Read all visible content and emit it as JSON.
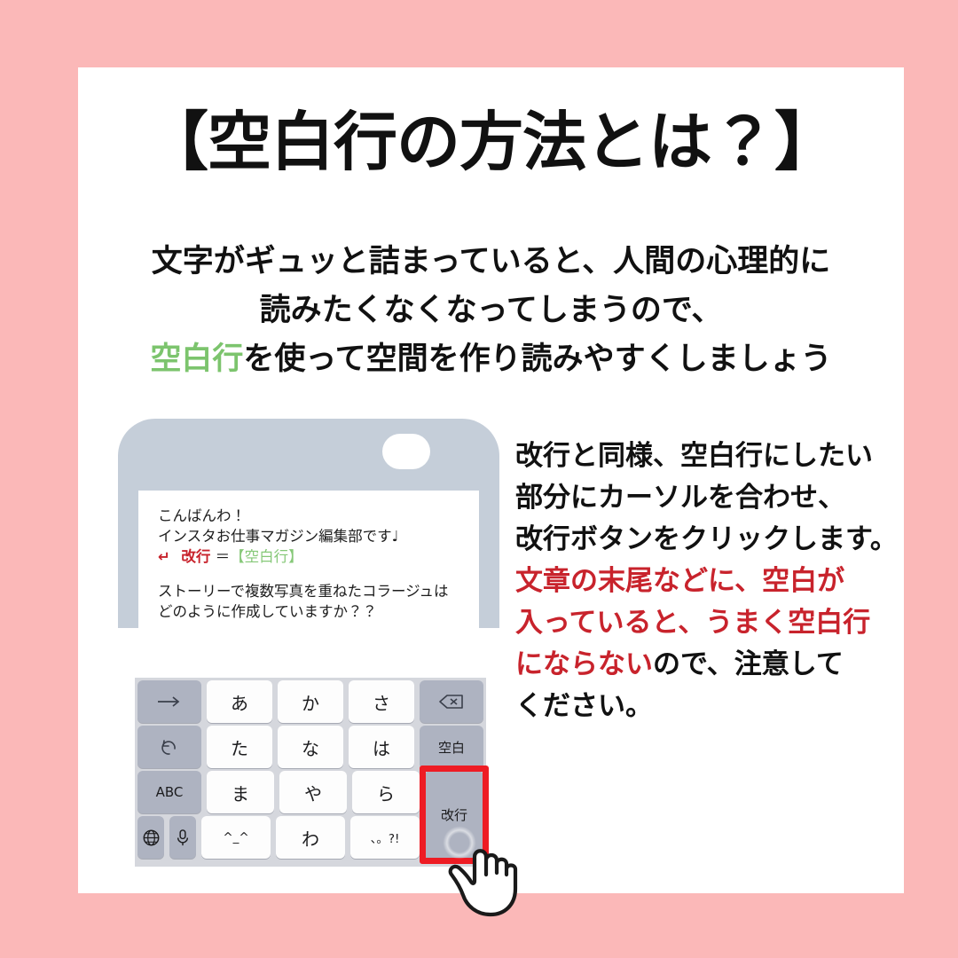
{
  "theme": {
    "page_background": "#fbb8b8",
    "card_background": "#ffffff",
    "text_primary": "#111111",
    "accent_green": "#7cc46d",
    "accent_red": "#c8232c",
    "highlight_red": "#ee1c24",
    "phone_body": "#c5ced9",
    "keyboard_background": "#d5d7dd",
    "key_gray": "#aeb3c1",
    "key_white": "#fdfdfd"
  },
  "title": "【空白行の方法とは？】",
  "lead": {
    "line1": "文字がギュッと詰まっていると、人間の心理的に",
    "line2": "読みたくなくなってしまうので、",
    "line3_green": "空白行",
    "line3_rest": "を使って空間を作り読みやすくしましょう"
  },
  "side_copy": {
    "line1": "改行と同様、空白行にしたい",
    "line2": "部分にカーソルを合わせ、",
    "line3": "改行ボタンをクリックします。",
    "line4_red": "文章の末尾などに、空白が",
    "line5_red": "入っていると、うまく空白行",
    "line6_red": "にならない",
    "line6_rest": "ので、注意して",
    "line7": "ください。"
  },
  "phone": {
    "message": {
      "line1": "こんばんわ！",
      "line2": "インスタお仕事マガジン編集部です♩",
      "line3_arrow": "↵",
      "line3_red": "改行",
      "line3_eq": "＝",
      "line3_green": "【空白行】",
      "line4": "ストーリーで複数写真を重ねたコラージュは",
      "line5": "どのように作成していますか？？"
    }
  },
  "keyboard": {
    "rows": [
      [
        {
          "label": "→",
          "style": "gray",
          "icon": "arrow-right-icon"
        },
        {
          "label": "あ",
          "style": "white"
        },
        {
          "label": "か",
          "style": "white"
        },
        {
          "label": "さ",
          "style": "white"
        },
        {
          "label": "",
          "style": "gray",
          "icon": "backspace-icon"
        }
      ],
      [
        {
          "label": "↺",
          "style": "gray",
          "icon": "undo-icon"
        },
        {
          "label": "た",
          "style": "white"
        },
        {
          "label": "な",
          "style": "white"
        },
        {
          "label": "は",
          "style": "white"
        },
        {
          "label": "空白",
          "style": "gray"
        }
      ],
      [
        {
          "label": "ABC",
          "style": "gray"
        },
        {
          "label": "ま",
          "style": "white"
        },
        {
          "label": "や",
          "style": "white"
        },
        {
          "label": "ら",
          "style": "white"
        }
      ],
      [
        {
          "label": "",
          "style": "gray",
          "icon": "globe-icon"
        },
        {
          "label": "",
          "style": "gray",
          "icon": "microphone-icon"
        },
        {
          "label": "^_^",
          "style": "white"
        },
        {
          "label": "わ",
          "style": "white"
        },
        {
          "label": "、。?!",
          "style": "white"
        }
      ]
    ],
    "enter_key_label": "改行",
    "cursor": "pointing-hand-cursor"
  }
}
